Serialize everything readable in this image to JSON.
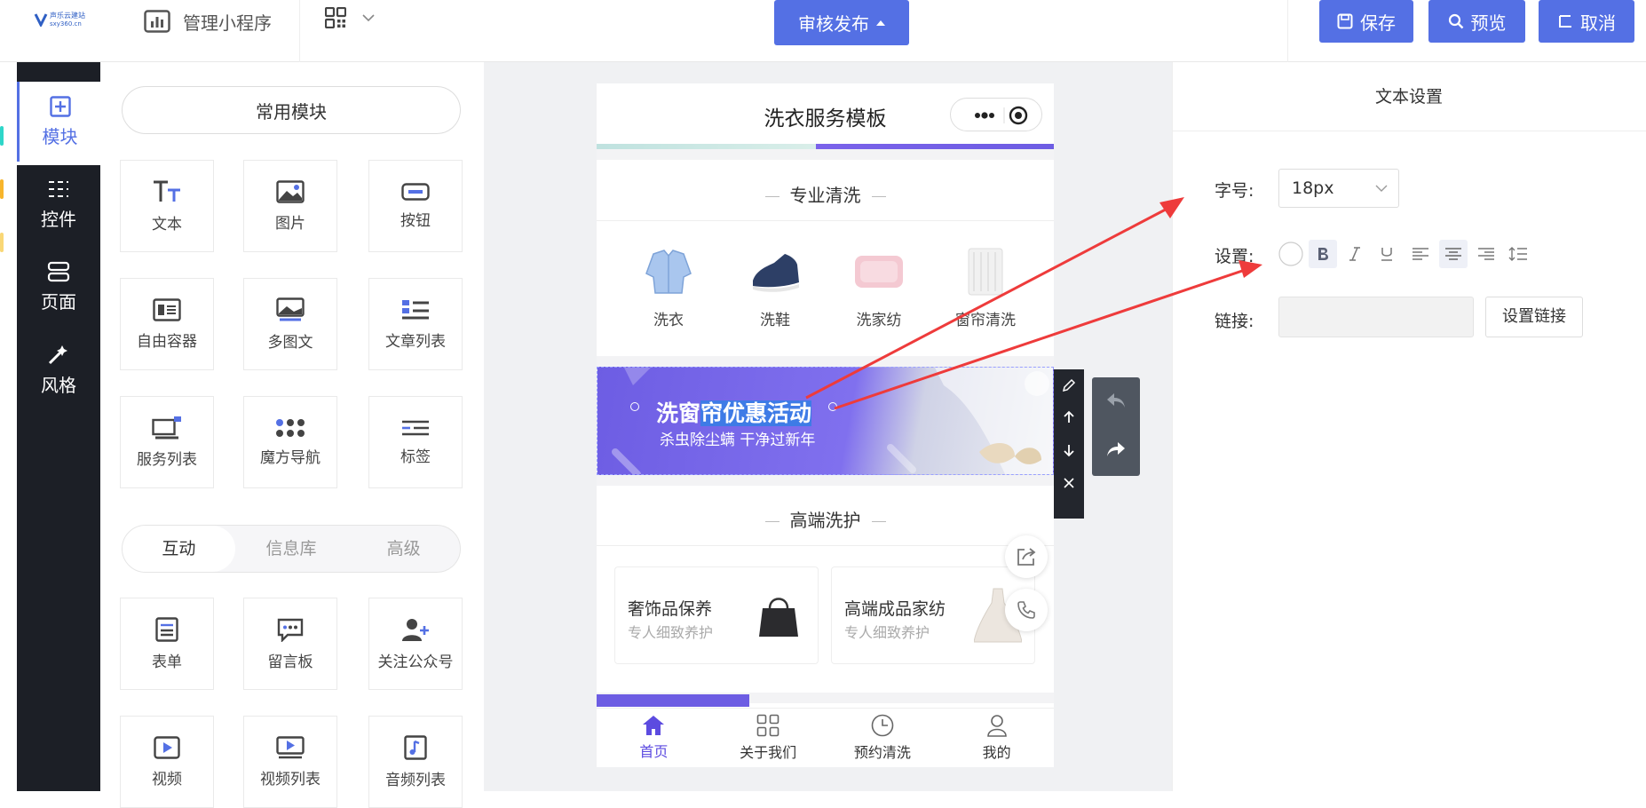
{
  "header": {
    "logo_line1": "声乐云建站",
    "logo_line2": "sxy360.cn",
    "app_name": "管理小程序",
    "publish_label": "审核发布",
    "save_label": "保存",
    "preview_label": "预览",
    "cancel_label": "取消",
    "accent_color": "#5470e4"
  },
  "sidebar": {
    "items": [
      {
        "label": "模块",
        "icon": "plus-square-icon",
        "active": true
      },
      {
        "label": "控件",
        "icon": "sliders-icon"
      },
      {
        "label": "页面",
        "icon": "pages-icon"
      },
      {
        "label": "风格",
        "icon": "magic-wand-icon"
      }
    ]
  },
  "modules": {
    "common_label": "常用模块",
    "common": [
      {
        "label": "文本",
        "icon": "text-icon"
      },
      {
        "label": "图片",
        "icon": "image-icon"
      },
      {
        "label": "按钮",
        "icon": "button-icon"
      },
      {
        "label": "自由容器",
        "icon": "container-icon"
      },
      {
        "label": "多图文",
        "icon": "multi-image-icon"
      },
      {
        "label": "文章列表",
        "icon": "article-list-icon"
      },
      {
        "label": "服务列表",
        "icon": "service-list-icon"
      },
      {
        "label": "魔方导航",
        "icon": "grid-nav-icon"
      },
      {
        "label": "标签",
        "icon": "tag-icon"
      }
    ],
    "tabs": [
      "互动",
      "信息库",
      "高级"
    ],
    "interactive": [
      {
        "label": "表单",
        "icon": "form-icon"
      },
      {
        "label": "留言板",
        "icon": "message-icon"
      },
      {
        "label": "关注公众号",
        "icon": "follow-icon"
      },
      {
        "label": "视频",
        "icon": "video-icon"
      },
      {
        "label": "视频列表",
        "icon": "video-list-icon"
      },
      {
        "label": "音频列表",
        "icon": "audio-list-icon"
      }
    ]
  },
  "phone": {
    "title": "洗衣服务模板",
    "section1_title": "专业清洗",
    "services": [
      {
        "label": "洗衣",
        "icon": "shirt-icon"
      },
      {
        "label": "洗鞋",
        "icon": "shoe-icon"
      },
      {
        "label": "洗家纺",
        "icon": "quilt-icon"
      },
      {
        "label": "窗帘清洗",
        "icon": "curtain-icon"
      }
    ],
    "banner_title_a": "洗窗",
    "banner_title_b": "帘优惠活动",
    "banner_sub": "杀虫除尘螨 干净过新年",
    "section2_title": "高端洗护",
    "cards": [
      {
        "name": "奢饰品保养",
        "sub": "专人细致养护",
        "icon": "handbag-icon"
      },
      {
        "name": "高端成品家纺",
        "sub": "专人细致养护",
        "icon": "dress-icon"
      }
    ],
    "tabbar": [
      {
        "label": "首页",
        "icon": "home-icon",
        "active": true
      },
      {
        "label": "关于我们",
        "icon": "grid-icon"
      },
      {
        "label": "预约清洗",
        "icon": "clock-icon"
      },
      {
        "label": "我的",
        "icon": "user-icon"
      }
    ],
    "brand_purple": "#6d5de3"
  },
  "settings": {
    "title": "文本设置",
    "size_label": "字号:",
    "size_value": "18px",
    "format_label": "设置:",
    "link_label": "链接:",
    "link_value": "",
    "link_button": "设置链接"
  }
}
